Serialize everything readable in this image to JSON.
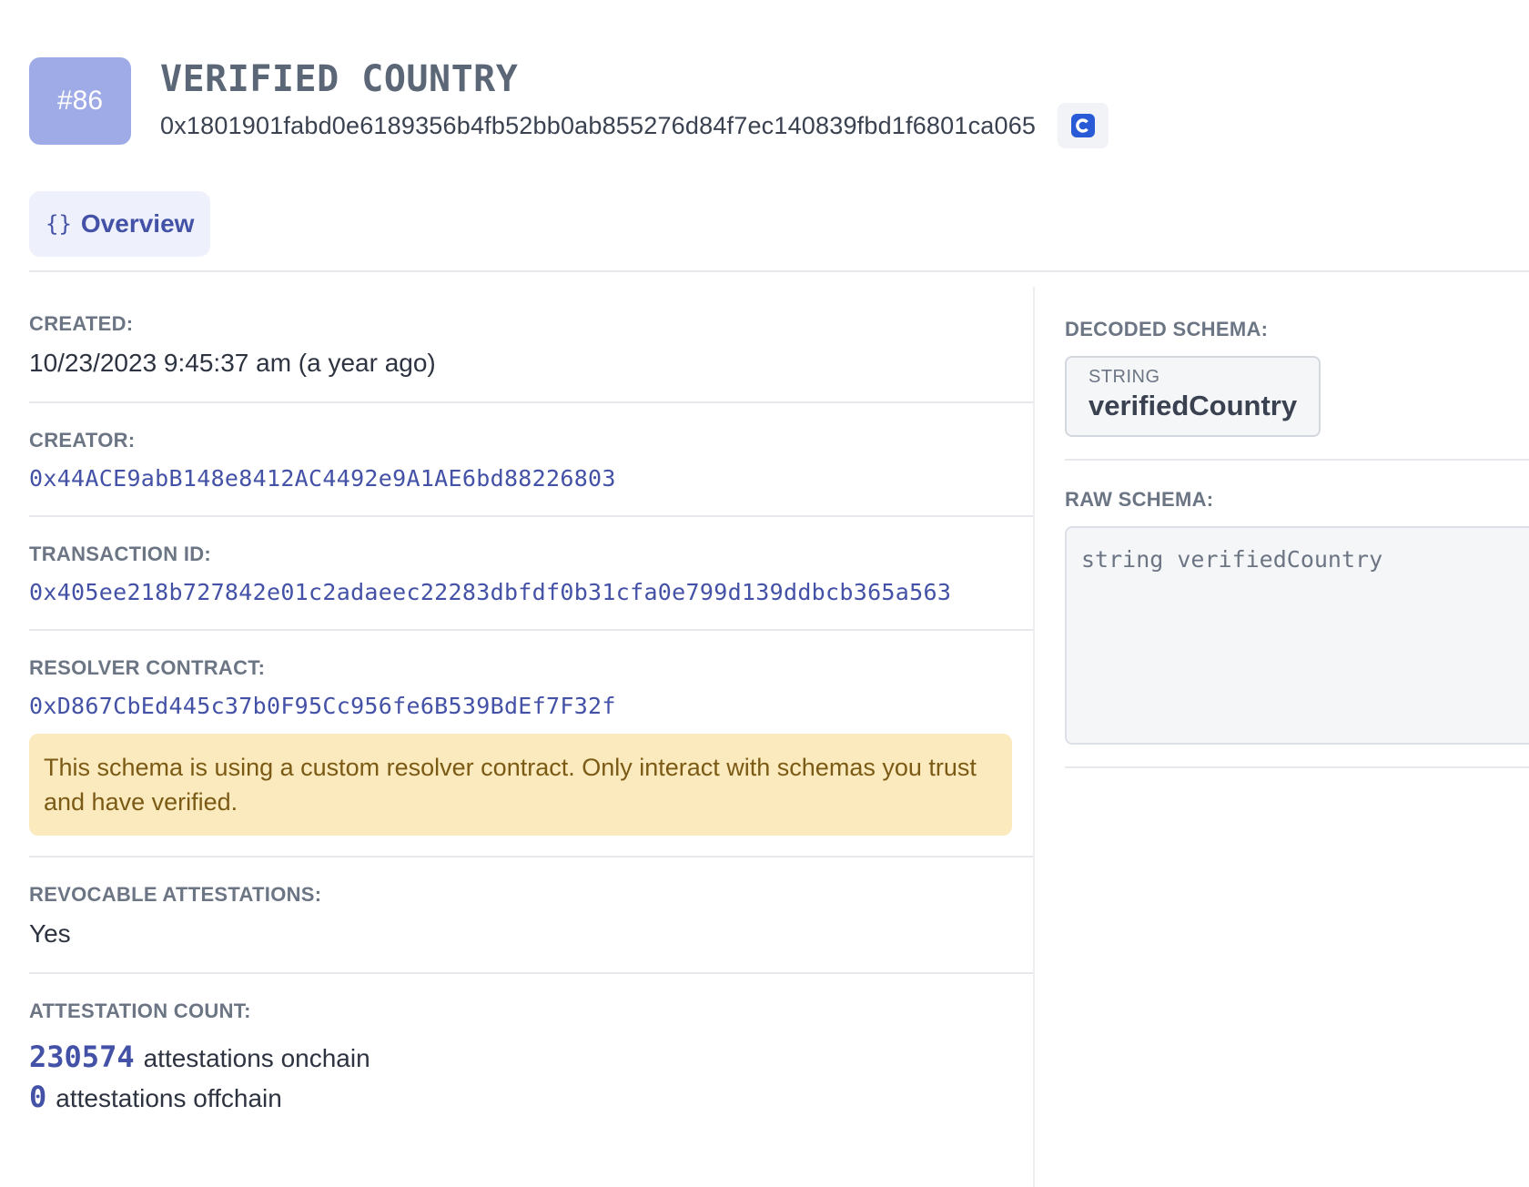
{
  "schema": {
    "number": "#86",
    "title": "VERIFIED COUNTRY",
    "uid": "0x1801901fabd0e6189356b4fb52bb0ab855276d84f7ec140839fbd1f6801ca065"
  },
  "tabs": [
    {
      "icon": "{}",
      "label": "Overview"
    }
  ],
  "details": {
    "created": {
      "label": "CREATED:",
      "value": "10/23/2023 9:45:37 am (a year ago)"
    },
    "creator": {
      "label": "CREATOR:",
      "value": "0x44ACE9abB148e8412AC4492e9A1AE6bd88226803"
    },
    "transaction": {
      "label": "TRANSACTION ID:",
      "value": "0x405ee218b727842e01c2adaeec22283dbfdf0b31cfa0e799d139ddbcb365a563"
    },
    "resolver": {
      "label": "RESOLVER CONTRACT:",
      "value": "0xD867CbEd445c37b0F95Cc956fe6B539BdEf7F32f",
      "warning": "This schema is using a custom resolver contract. Only interact with schemas you trust and have verified."
    },
    "revocable": {
      "label": "REVOCABLE ATTESTATIONS:",
      "value": "Yes"
    },
    "count": {
      "label": "ATTESTATION COUNT:",
      "onchain_num": "230574",
      "onchain_text": "attestations onchain",
      "offchain_num": "0",
      "offchain_text": "attestations offchain"
    }
  },
  "decoded_schema": {
    "label": "DECODED SCHEMA:",
    "fields": [
      {
        "type": "STRING",
        "name": "verifiedCountry"
      }
    ]
  },
  "raw_schema": {
    "label": "RAW SCHEMA:",
    "value": "string verifiedCountry"
  },
  "colors": {
    "accent": "#4351a6",
    "badge": "#9fabe6",
    "warning_bg": "#fbeabd",
    "copy_icon": "#2a5bd7"
  },
  "icons": {
    "copy": "copy-icon",
    "tab": "braces-icon"
  }
}
